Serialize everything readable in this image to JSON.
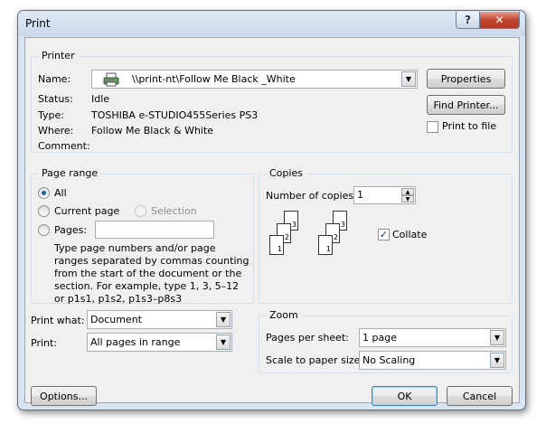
{
  "window": {
    "title": "Print",
    "help_glyph": "?",
    "close_glyph": "✕"
  },
  "printer": {
    "group_title": "Printer",
    "name_label": "Name:",
    "name_value": "\\\\print-nt\\Follow Me Black _White",
    "status_label": "Status:",
    "status_value": "Idle",
    "type_label": "Type:",
    "type_value": "TOSHIBA e-STUDIO455Series PS3",
    "where_label": "Where:",
    "where_value": "Follow Me Black & White",
    "comment_label": "Comment:",
    "comment_value": "",
    "properties_label": "Properties",
    "find_printer_label": "Find Printer...",
    "print_to_file_label": "Print to file",
    "print_to_file_checked": false
  },
  "page_range": {
    "group_title": "Page range",
    "all_label": "All",
    "current_page_label": "Current page",
    "selection_label": "Selection",
    "pages_label": "Pages:",
    "pages_value": "",
    "help_lines": [
      "Type page numbers and/or page",
      "ranges separated by commas counting",
      "from the start of the document or the",
      "section. For example, type 1, 3, 5–12",
      "or p1s1, p1s2, p1s3–p8s3"
    ]
  },
  "copies": {
    "group_title": "Copies",
    "number_label": "Number of copies:",
    "number_value": "1",
    "collate_label": "Collate",
    "collate_checked": true,
    "page_numbers": [
      "1",
      "2",
      "3"
    ]
  },
  "print_what": {
    "label": "Print what:",
    "value": "Document"
  },
  "print": {
    "label": "Print:",
    "value": "All pages in range"
  },
  "zoom": {
    "group_title": "Zoom",
    "pages_per_sheet_label": "Pages per sheet:",
    "pages_per_sheet_value": "1 page",
    "scale_label": "Scale to paper size:",
    "scale_value": "No Scaling"
  },
  "footer": {
    "options_label": "Options...",
    "ok_label": "OK",
    "cancel_label": "Cancel"
  },
  "icons": {
    "dropdown": "▼",
    "spin_up": "▲",
    "spin_down": "▼",
    "check": "✓"
  }
}
